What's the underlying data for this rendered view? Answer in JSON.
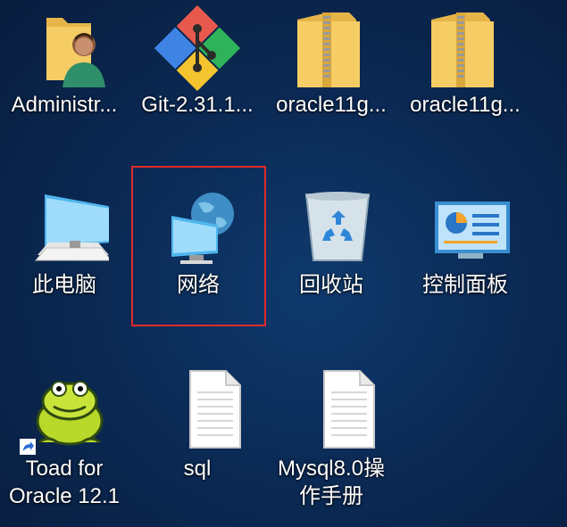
{
  "desktop": {
    "icons": [
      {
        "label": "Administr...",
        "icon": "user-folder-icon"
      },
      {
        "label": "Git-2.31.1...",
        "icon": "git-icon"
      },
      {
        "label": "oracle11g...",
        "icon": "zip-folder-icon"
      },
      {
        "label": "oracle11g...",
        "icon": "zip-folder-icon"
      },
      {
        "label": "此电脑",
        "icon": "computer-icon"
      },
      {
        "label": "网络",
        "icon": "network-icon"
      },
      {
        "label": "回收站",
        "icon": "recycle-bin-icon"
      },
      {
        "label": "控制面板",
        "icon": "control-panel-icon"
      },
      {
        "label_line1": "Toad for",
        "label_line2": "Oracle 12.1",
        "icon": "toad-icon"
      },
      {
        "label": "sql",
        "icon": "text-file-icon"
      },
      {
        "label_line1": "Mysql8.0操",
        "label_line2": "作手册",
        "icon": "text-file-icon"
      }
    ]
  },
  "colors": {
    "selection_border": "#e02b2b",
    "background": "#0b2a55",
    "folder": "#f3c75d"
  }
}
